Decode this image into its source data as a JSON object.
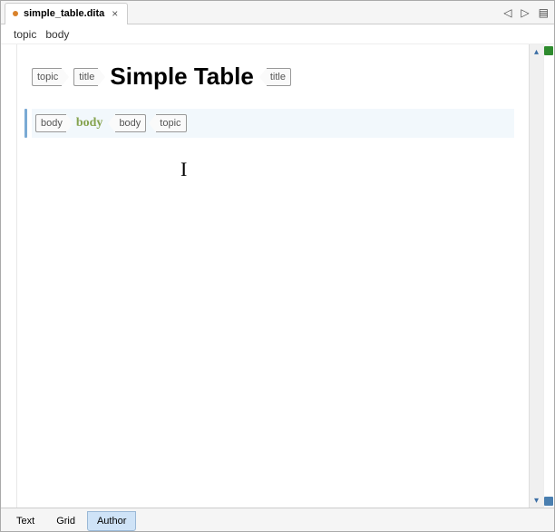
{
  "tab": {
    "name": "simple_table.dita",
    "dirty": true
  },
  "breadcrumb": {
    "items": [
      "topic",
      "body"
    ]
  },
  "doc": {
    "title_line": {
      "tag_topic": "topic",
      "tag_title": "title",
      "title_text": "Simple Table"
    },
    "body_line": {
      "tag_body": "body",
      "placeholder": "body"
    }
  },
  "bottom_tabs": {
    "text": "Text",
    "grid": "Grid",
    "author": "Author",
    "active": "author"
  }
}
